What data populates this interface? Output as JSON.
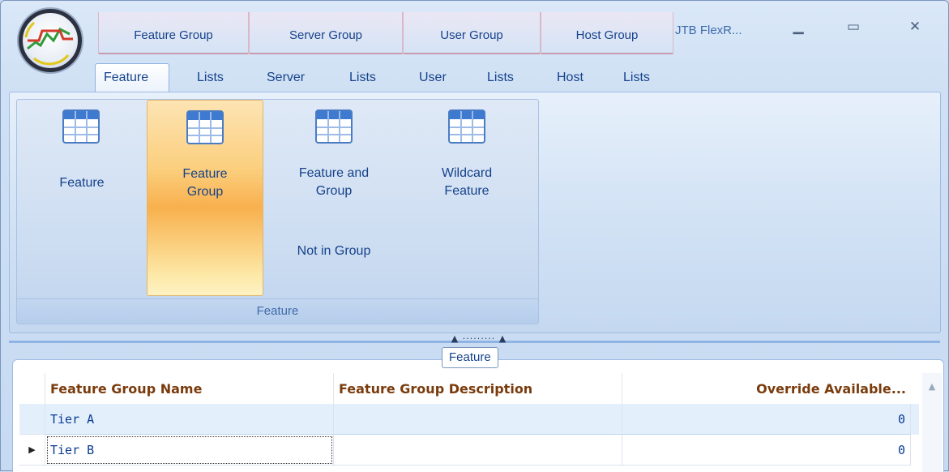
{
  "window": {
    "title": "JTB FlexR...",
    "controls": {
      "minimize": "▁",
      "maximize": "▭",
      "close": "✕"
    }
  },
  "context_groups": [
    {
      "label": "Feature Group"
    },
    {
      "label": "Server Group"
    },
    {
      "label": "User Group"
    },
    {
      "label": "Host Group"
    }
  ],
  "tabs": [
    {
      "label": "Feature",
      "active": true
    },
    {
      "label": "Lists"
    },
    {
      "label": "Server"
    },
    {
      "label": "Lists"
    },
    {
      "label": "User"
    },
    {
      "label": "Lists"
    },
    {
      "label": "Host"
    },
    {
      "label": "Lists"
    }
  ],
  "ribbon": {
    "group_label": "Feature",
    "buttons": [
      {
        "label": "Feature",
        "icon": "table-icon"
      },
      {
        "label_line1": "Feature",
        "label_line2": "Group",
        "icon": "table-icon",
        "selected": true
      },
      {
        "label_line1": "Feature and",
        "label_line2": "Group",
        "label_line3": "Not in Group",
        "icon": "table-icon"
      },
      {
        "label_line1": "Wildcard",
        "label_line2": "Feature",
        "icon": "table-icon"
      }
    ]
  },
  "splitter": {
    "grip": "▲ ········· ▲"
  },
  "grid_panel": {
    "caption": "Feature",
    "columns": [
      "Feature Group Name",
      "Feature Group Description",
      "Override Available..."
    ],
    "rows": [
      {
        "name": "Tier A",
        "description": "",
        "override": "0"
      },
      {
        "name": "Tier B",
        "description": "",
        "override": "0",
        "current_marker": "▶"
      }
    ]
  }
}
